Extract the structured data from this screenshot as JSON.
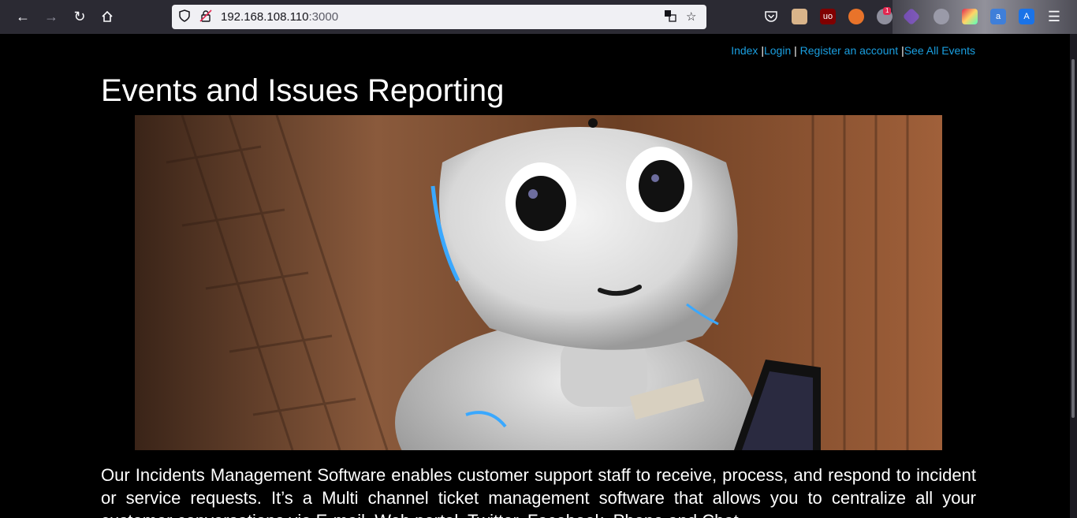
{
  "browser": {
    "url_host": "192.168.108.110",
    "url_port": ":3000",
    "badge_count": "1",
    "icons": [
      "back-icon",
      "forward-icon",
      "reload-icon",
      "home-icon",
      "shield-icon",
      "insecure-lock-icon",
      "translate-icon",
      "star-icon",
      "pocket-icon",
      "menu-icon"
    ]
  },
  "nav": {
    "index": "Index",
    "sep1": " |",
    "login": "Login",
    "sep2": " | ",
    "register": "Register an account",
    "sep3": " |",
    "events": "See All Events"
  },
  "page": {
    "title": "Events and Issues Reporting",
    "intro": "Our Incidents Management Software enables customer support staff to receive, process, and respond to incident or service requests. It’s a Multi channel ticket management software that allows you to centralize all your customer conversations via E-mail, Web portal, Twitter, Facebook, Phone and Chat."
  },
  "colors": {
    "link": "#1a9fe0",
    "background": "#000000",
    "toolbar": "#2b2a33"
  }
}
